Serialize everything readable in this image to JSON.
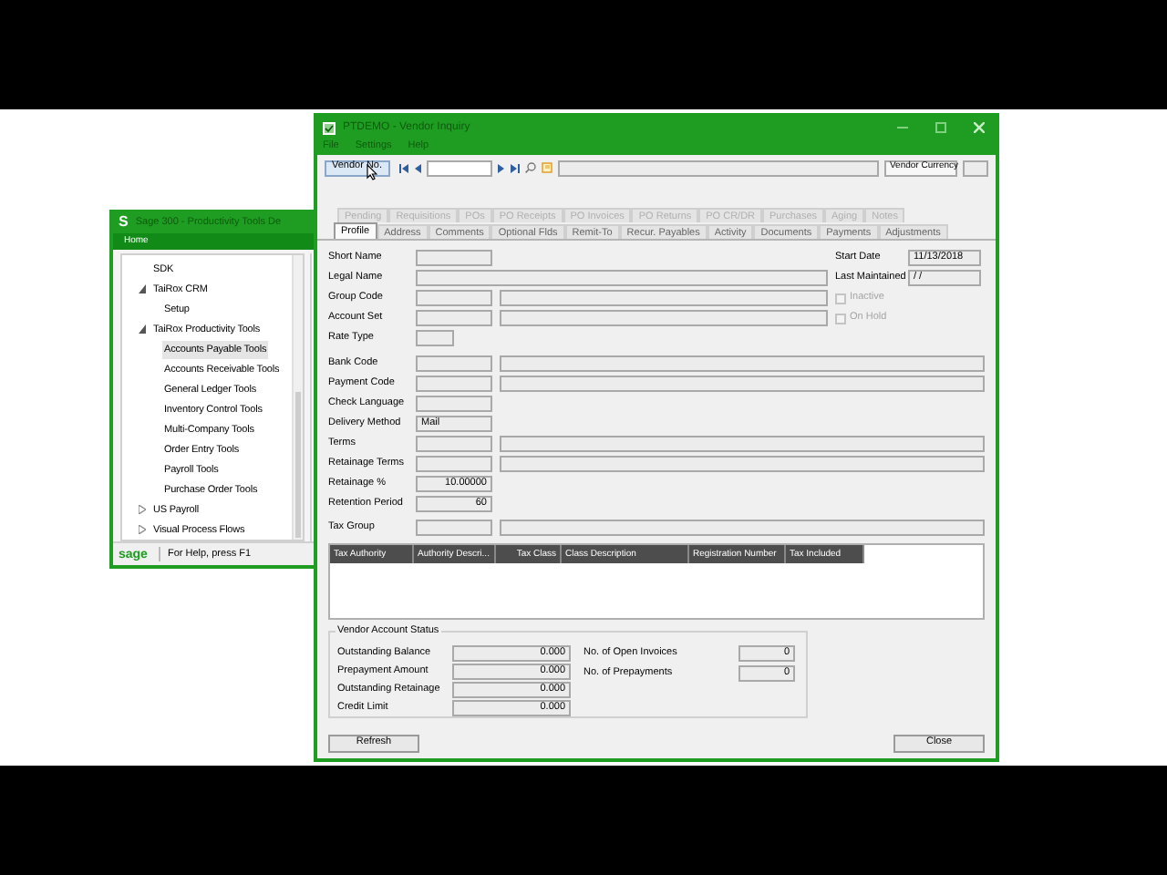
{
  "back_window": {
    "logo": "S",
    "title": "Sage 300 - Productivity Tools De",
    "home_tab": "Home",
    "tree": [
      {
        "label": "SDK",
        "kind": "item"
      },
      {
        "label": "TaiRox CRM",
        "kind": "folder",
        "expanded": true,
        "children": [
          {
            "label": "Setup",
            "selected": false
          }
        ]
      },
      {
        "label": "TaiRox Productivity Tools",
        "kind": "folder",
        "expanded": true,
        "children": [
          {
            "label": "Accounts Payable Tools",
            "selected": true
          },
          {
            "label": "Accounts Receivable Tools",
            "selected": false
          },
          {
            "label": "General Ledger Tools",
            "selected": false
          },
          {
            "label": "Inventory Control Tools",
            "selected": false
          },
          {
            "label": "Multi-Company Tools",
            "selected": false
          },
          {
            "label": "Order Entry Tools",
            "selected": false
          },
          {
            "label": "Payroll Tools",
            "selected": false
          },
          {
            "label": "Purchase Order Tools",
            "selected": false
          }
        ]
      },
      {
        "label": "US Payroll",
        "kind": "folder",
        "expanded": false
      },
      {
        "label": "Visual Process Flows",
        "kind": "folder",
        "expanded": false
      }
    ],
    "status_bar": {
      "logo": "sage",
      "text": "For Help, press F1"
    }
  },
  "window": {
    "title": "PTDEMO - Vendor Inquiry",
    "menu": [
      "File",
      "Settings",
      "Help"
    ],
    "toolbar": {
      "vendor_button": "Vendor No.",
      "currency_label": "Vendor Currency"
    },
    "tab_rows": [
      [
        {
          "label": "Pending",
          "selected": false,
          "disabled": true
        },
        {
          "label": "Requisitions",
          "selected": false,
          "disabled": true
        },
        {
          "label": "POs",
          "selected": false,
          "disabled": true
        },
        {
          "label": "PO Receipts",
          "selected": false,
          "disabled": true
        },
        {
          "label": "PO Invoices",
          "selected": false,
          "disabled": true
        },
        {
          "label": "PO Returns",
          "selected": false,
          "disabled": true
        },
        {
          "label": "PO CR/DR",
          "selected": false,
          "disabled": true
        },
        {
          "label": "Purchases",
          "selected": false,
          "disabled": true
        },
        {
          "label": "Aging",
          "selected": false,
          "disabled": true
        },
        {
          "label": "Notes",
          "selected": false,
          "disabled": true
        }
      ],
      [
        {
          "label": "Profile",
          "selected": true,
          "disabled": false
        },
        {
          "label": "Address",
          "selected": false,
          "disabled": false
        },
        {
          "label": "Comments",
          "selected": false,
          "disabled": false
        },
        {
          "label": "Optional Flds",
          "selected": false,
          "disabled": false
        },
        {
          "label": "Remit-To",
          "selected": false,
          "disabled": false
        },
        {
          "label": "Recur. Payables",
          "selected": false,
          "disabled": false
        },
        {
          "label": "Activity",
          "selected": false,
          "disabled": false
        },
        {
          "label": "Documents",
          "selected": false,
          "disabled": false
        },
        {
          "label": "Payments",
          "selected": false,
          "disabled": false
        },
        {
          "label": "Adjustments",
          "selected": false,
          "disabled": false
        }
      ]
    ],
    "side_fields": [
      {
        "label": "Start Date",
        "kind": "field",
        "value": "11/13/2018"
      },
      {
        "label": "Last Maintained",
        "kind": "field",
        "value": "/  /"
      },
      {
        "label": "Inactive",
        "kind": "checkbox",
        "checked": false,
        "disabled": true
      },
      {
        "label": "On Hold",
        "kind": "checkbox",
        "checked": false,
        "disabled": true
      }
    ],
    "form": [
      {
        "label": "Short Name",
        "kind": "short"
      },
      {
        "label": "Legal Name",
        "kind": "long"
      },
      {
        "label": "Group Code",
        "kind": "code_desc"
      },
      {
        "label": "Account Set",
        "kind": "code_desc"
      },
      {
        "label": "Rate Type",
        "kind": "tiny"
      },
      {
        "label": "Bank Code",
        "kind": "code_desc"
      },
      {
        "label": "Payment Code",
        "kind": "code_desc"
      },
      {
        "label": "Check Language",
        "kind": "short"
      },
      {
        "label": "Delivery Method",
        "kind": "short",
        "value": "Mail"
      },
      {
        "label": "Terms",
        "kind": "code_desc"
      },
      {
        "label": "Retainage Terms",
        "kind": "code_desc"
      },
      {
        "label": "Retainage %",
        "kind": "number",
        "value": "10.00000"
      },
      {
        "label": "Retention Period",
        "kind": "number",
        "value": "60"
      },
      {
        "label": "Tax Group",
        "kind": "code_desc"
      }
    ],
    "table": {
      "columns": [
        "Tax Authority",
        "Authority Descri...",
        "Tax Class",
        "Class Description",
        "Registration Number",
        "Tax Included"
      ]
    },
    "status_group": {
      "title": "Vendor Account Status",
      "left": [
        {
          "label": "Outstanding Balance",
          "value": "0.000"
        },
        {
          "label": "Prepayment Amount",
          "value": "0.000"
        },
        {
          "label": "Outstanding Retainage",
          "value": "0.000"
        },
        {
          "label": "Credit Limit",
          "value": "0.000"
        }
      ],
      "right": [
        {
          "label": "No. of Open Invoices",
          "value": "0"
        },
        {
          "label": "No. of Prepayments",
          "value": "0"
        }
      ]
    },
    "buttons": [
      "Refresh",
      "Close"
    ]
  }
}
